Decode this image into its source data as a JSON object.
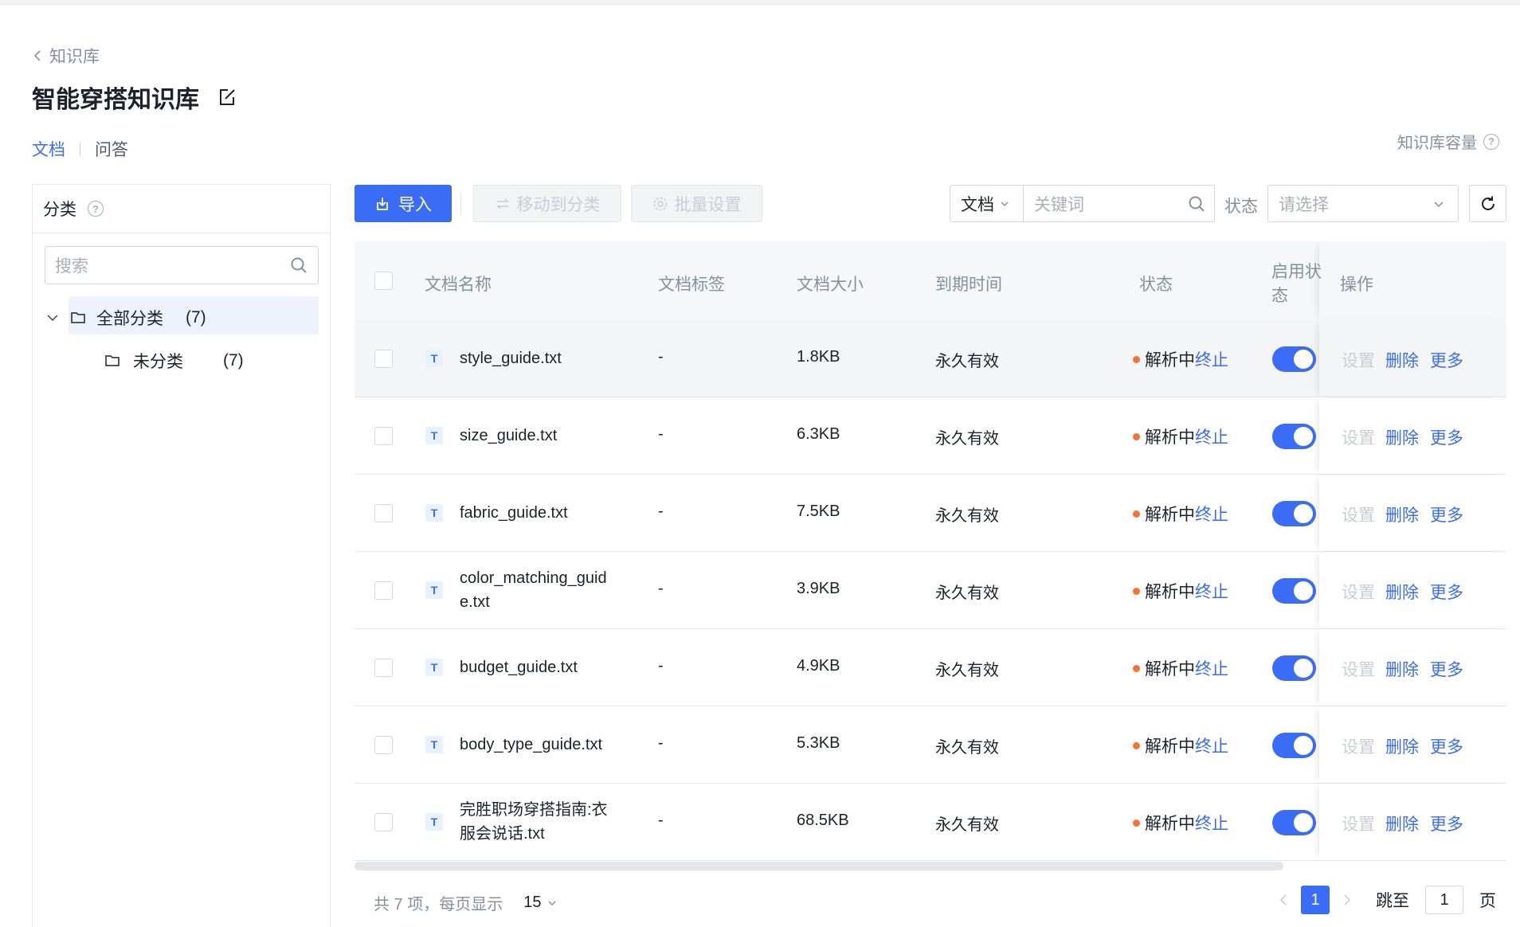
{
  "breadcrumb": {
    "back_label": "知识库"
  },
  "page": {
    "title": "智能穿搭知识库"
  },
  "tabs": [
    {
      "label": "文档"
    },
    {
      "label": "问答"
    }
  ],
  "capacity": {
    "label": "知识库容量"
  },
  "sidebar": {
    "header": "分类",
    "search_placeholder": "搜索",
    "tree": {
      "all": {
        "label": "全部分类",
        "count": "(7)"
      },
      "uncategorized": {
        "label": "未分类",
        "count": "(7)"
      }
    }
  },
  "toolbar": {
    "import_label": "导入",
    "move_label": "移动到分类",
    "batch_label": "批量设置",
    "filter_type": "文档",
    "keyword_placeholder": "关键词",
    "status_label": "状态",
    "status_placeholder": "请选择"
  },
  "table": {
    "columns": {
      "name": "文档名称",
      "tags": "文档标签",
      "size": "文档大小",
      "expire": "到期时间",
      "status": "状态",
      "enabled_line1": "启用状",
      "enabled_line2": "态",
      "ops": "操作"
    },
    "rows": [
      {
        "name": "style_guide.txt",
        "tags": "-",
        "size": "1.8KB",
        "expire": "永久有效",
        "status": "解析中",
        "stop": "终止",
        "enabled": true
      },
      {
        "name": "size_guide.txt",
        "tags": "-",
        "size": "6.3KB",
        "expire": "永久有效",
        "status": "解析中",
        "stop": "终止",
        "enabled": true
      },
      {
        "name": "fabric_guide.txt",
        "tags": "-",
        "size": "7.5KB",
        "expire": "永久有效",
        "status": "解析中",
        "stop": "终止",
        "enabled": true
      },
      {
        "name": "color_matching_guide.txt",
        "tags": "-",
        "size": "3.9KB",
        "expire": "永久有效",
        "status": "解析中",
        "stop": "终止",
        "enabled": true
      },
      {
        "name": "budget_guide.txt",
        "tags": "-",
        "size": "4.9KB",
        "expire": "永久有效",
        "status": "解析中",
        "stop": "终止",
        "enabled": true
      },
      {
        "name": "body_type_guide.txt",
        "tags": "-",
        "size": "5.3KB",
        "expire": "永久有效",
        "status": "解析中",
        "stop": "终止",
        "enabled": true
      },
      {
        "name": "完胜职场穿搭指南:衣服会说话.txt",
        "tags": "-",
        "size": "68.5KB",
        "expire": "永久有效",
        "status": "解析中",
        "stop": "终止",
        "enabled": true
      }
    ],
    "actions": {
      "settings": "设置",
      "delete": "删除",
      "more": "更多"
    }
  },
  "pagination": {
    "total_text": "共 7 项，每页显示",
    "page_size": "15",
    "current_page": "1",
    "jump_label": "跳至",
    "jump_value": "1",
    "page_unit": "页"
  },
  "colors": {
    "accent": "#3b6cf6",
    "status_dot": "#f77234"
  }
}
